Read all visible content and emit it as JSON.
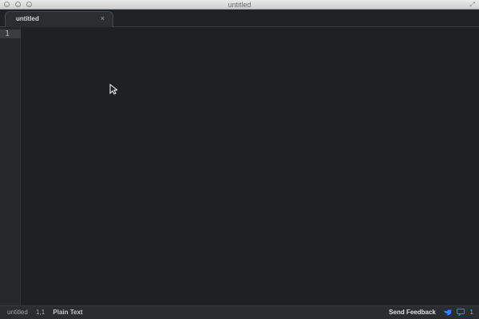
{
  "window": {
    "title": "untitled"
  },
  "tabs": [
    {
      "label": "untitled",
      "close_icon": "close-icon"
    }
  ],
  "editor": {
    "line_numbers": [
      "1"
    ],
    "cursor_icon": "mouse-pointer-icon"
  },
  "statusbar": {
    "file": "untitled",
    "position": "1,1",
    "syntax": "Plain Text",
    "send_feedback": "Send Feedback",
    "notification_count": "1"
  },
  "colors": {
    "accent": "#2f86ff",
    "background": "#1e2022"
  }
}
